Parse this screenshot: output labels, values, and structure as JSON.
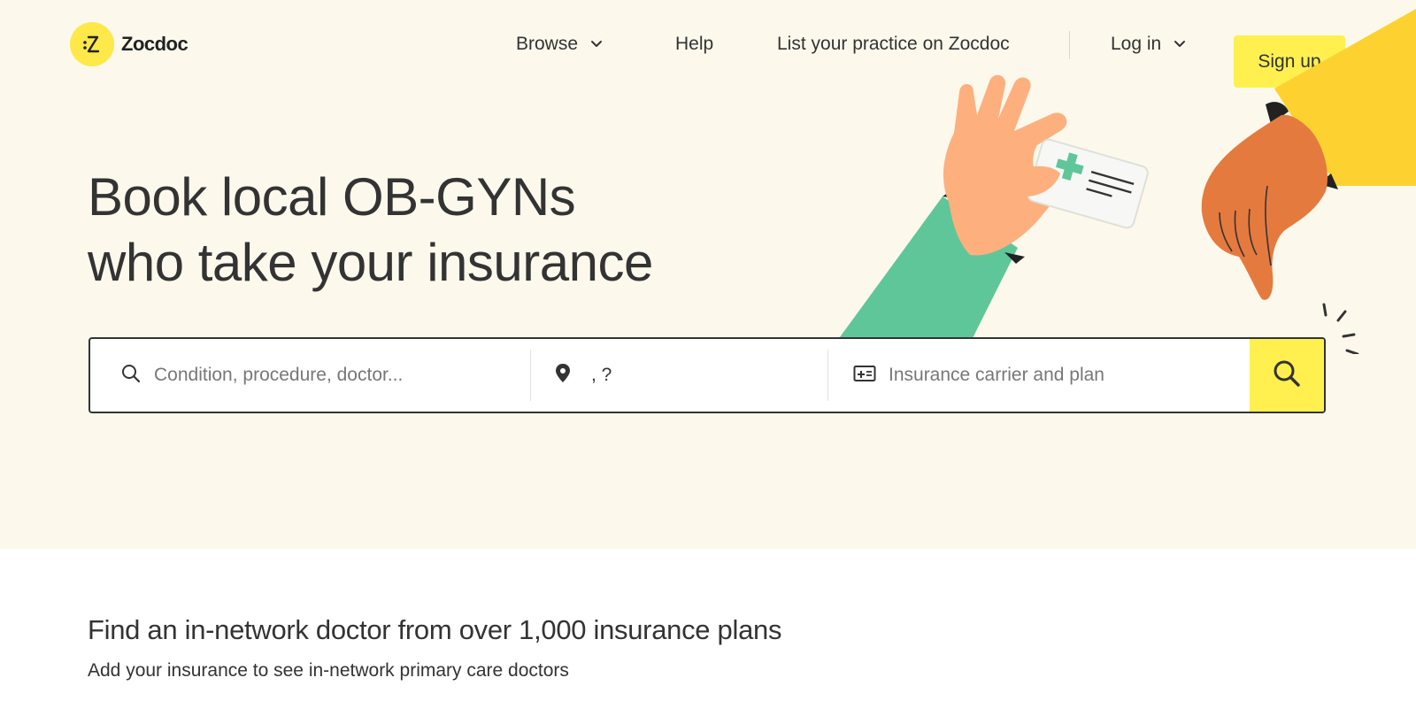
{
  "brand": {
    "name": "Zocdoc"
  },
  "nav": {
    "browse": "Browse",
    "help": "Help",
    "list_practice": "List your practice on Zocdoc",
    "login": "Log in",
    "signup": "Sign up"
  },
  "hero": {
    "headline_line1": "Book local OB-GYNs",
    "headline_line2": "who take your insurance"
  },
  "search": {
    "condition_placeholder": "Condition, procedure, doctor...",
    "location_value": ", ?",
    "insurance_placeholder": "Insurance carrier and plan"
  },
  "insurance_section": {
    "title": "Find an in-network doctor from over 1,000 insurance plans",
    "subtitle": "Add your insurance to see in-network primary care doctors"
  },
  "colors": {
    "hero_bg": "#fcf9ec",
    "accent_yellow": "#fff04f",
    "text": "#333333",
    "green_sleeve": "#5fc69a",
    "skin_light": "#fdb07e",
    "skin_dark": "#e57a3f"
  },
  "icons": [
    "zocdoc-logo-icon",
    "chevron-down-icon",
    "search-icon",
    "map-pin-icon",
    "insurance-card-icon"
  ]
}
